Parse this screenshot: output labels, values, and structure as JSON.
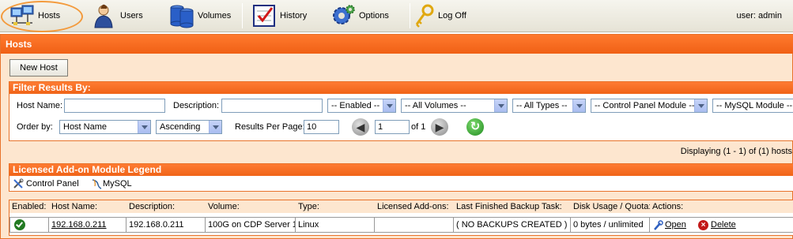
{
  "toolbar": {
    "items": [
      {
        "label": "Hosts"
      },
      {
        "label": "Users"
      },
      {
        "label": "Volumes"
      },
      {
        "label": "History"
      },
      {
        "label": "Options"
      },
      {
        "label": "Log Off"
      }
    ],
    "user_label": "user: admin"
  },
  "page": {
    "title": "Hosts",
    "new_host_label": "New Host"
  },
  "filter": {
    "title": "Filter Results By:",
    "host_name_label": "Host Name:",
    "host_name_value": "",
    "description_label": "Description:",
    "description_value": "",
    "enabled_select": "-- Enabled --",
    "volumes_select": "-- All Volumes --",
    "types_select": "-- All Types --",
    "cp_module_select": "-- Control Panel Module --",
    "mysql_module_select": "-- MySQL Module --",
    "order_by_label": "Order by:",
    "order_by_select": "Host Name",
    "direction_select": "Ascending",
    "results_per_page_label": "Results Per Page:",
    "results_per_page_value": "10",
    "page_value": "1",
    "of_pages": "of 1"
  },
  "displaying": "Displaying (1 - 1) of (1) hosts",
  "legend": {
    "title": "Licensed Add-on Module Legend",
    "items": [
      {
        "label": "Control Panel"
      },
      {
        "label": "MySQL"
      }
    ]
  },
  "table": {
    "headers": [
      "Enabled:",
      "Host Name:",
      "Description:",
      "Volume:",
      "Type:",
      "Licensed Add-ons:",
      "Last Finished Backup Task:",
      "Disk Usage / Quota:",
      "Actions:"
    ],
    "rows": [
      {
        "host_name": "192.168.0.211",
        "description": "192.168.0.211",
        "volume": "100G on CDP Server 1",
        "type": "Linux",
        "addons": "",
        "last_backup": "( NO BACKUPS CREATED )",
        "disk_usage": "0 bytes / unlimited",
        "open_label": "Open",
        "delete_label": "Delete"
      }
    ]
  },
  "colors": {
    "accent_orange": "#f06015",
    "frame_bg": "#fde6cf",
    "highlight_ring": "#f39a3c"
  }
}
